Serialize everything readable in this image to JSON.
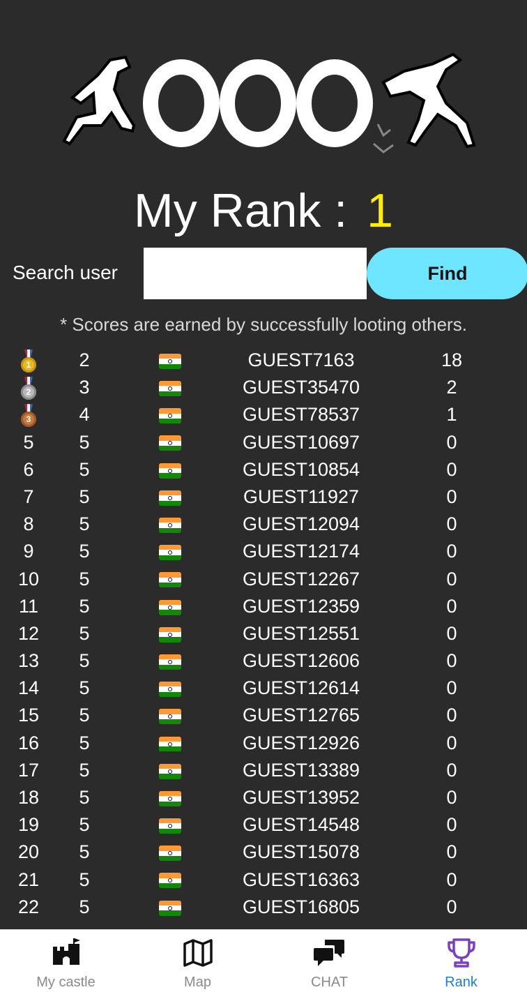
{
  "header": {
    "logo_icon": "pixel-runners-logo"
  },
  "my_rank": {
    "label": "My Rank :",
    "value": "1"
  },
  "search": {
    "label": "Search user",
    "value": "",
    "placeholder": "",
    "button_label": "Find"
  },
  "note": "* Scores are earned by successfully looting others.",
  "ranking": [
    {
      "pos": "",
      "medal": "gold",
      "medal_num": "1",
      "prev": "2",
      "flag": "india-flag",
      "name": "GUEST7163",
      "score": "18"
    },
    {
      "pos": "",
      "medal": "silver",
      "medal_num": "2",
      "prev": "3",
      "flag": "india-flag",
      "name": "GUEST35470",
      "score": "2"
    },
    {
      "pos": "",
      "medal": "bronze",
      "medal_num": "3",
      "prev": "4",
      "flag": "india-flag",
      "name": "GUEST78537",
      "score": "1"
    },
    {
      "pos": "5",
      "prev": "5",
      "flag": "india-flag",
      "name": "GUEST10697",
      "score": "0"
    },
    {
      "pos": "6",
      "prev": "5",
      "flag": "india-flag",
      "name": "GUEST10854",
      "score": "0"
    },
    {
      "pos": "7",
      "prev": "5",
      "flag": "india-flag",
      "name": "GUEST11927",
      "score": "0"
    },
    {
      "pos": "8",
      "prev": "5",
      "flag": "india-flag",
      "name": "GUEST12094",
      "score": "0"
    },
    {
      "pos": "9",
      "prev": "5",
      "flag": "india-flag",
      "name": "GUEST12174",
      "score": "0"
    },
    {
      "pos": "10",
      "prev": "5",
      "flag": "india-flag",
      "name": "GUEST12267",
      "score": "0"
    },
    {
      "pos": "11",
      "prev": "5",
      "flag": "india-flag",
      "name": "GUEST12359",
      "score": "0"
    },
    {
      "pos": "12",
      "prev": "5",
      "flag": "india-flag",
      "name": "GUEST12551",
      "score": "0"
    },
    {
      "pos": "13",
      "prev": "5",
      "flag": "india-flag",
      "name": "GUEST12606",
      "score": "0"
    },
    {
      "pos": "14",
      "prev": "5",
      "flag": "india-flag",
      "name": "GUEST12614",
      "score": "0"
    },
    {
      "pos": "15",
      "prev": "5",
      "flag": "india-flag",
      "name": "GUEST12765",
      "score": "0"
    },
    {
      "pos": "16",
      "prev": "5",
      "flag": "india-flag",
      "name": "GUEST12926",
      "score": "0"
    },
    {
      "pos": "17",
      "prev": "5",
      "flag": "india-flag",
      "name": "GUEST13389",
      "score": "0"
    },
    {
      "pos": "18",
      "prev": "5",
      "flag": "india-flag",
      "name": "GUEST13952",
      "score": "0"
    },
    {
      "pos": "19",
      "prev": "5",
      "flag": "india-flag",
      "name": "GUEST14548",
      "score": "0"
    },
    {
      "pos": "20",
      "prev": "5",
      "flag": "india-flag",
      "name": "GUEST15078",
      "score": "0"
    },
    {
      "pos": "21",
      "prev": "5",
      "flag": "india-flag",
      "name": "GUEST16363",
      "score": "0"
    },
    {
      "pos": "22",
      "prev": "5",
      "flag": "india-flag",
      "name": "GUEST16805",
      "score": "0"
    }
  ],
  "nav": [
    {
      "label": "My castle",
      "icon": "castle-icon",
      "active": false
    },
    {
      "label": "Map",
      "icon": "map-icon",
      "active": false
    },
    {
      "label": "CHAT",
      "icon": "chat-icon",
      "active": false
    },
    {
      "label": "Rank",
      "icon": "trophy-icon",
      "active": true
    }
  ],
  "colors": {
    "background": "#2b2b2b",
    "rank_value": "#ffee00",
    "find_button": "#6fe6ff",
    "active_nav": "#1a7fd6",
    "active_icon": "#7a3fc4"
  }
}
